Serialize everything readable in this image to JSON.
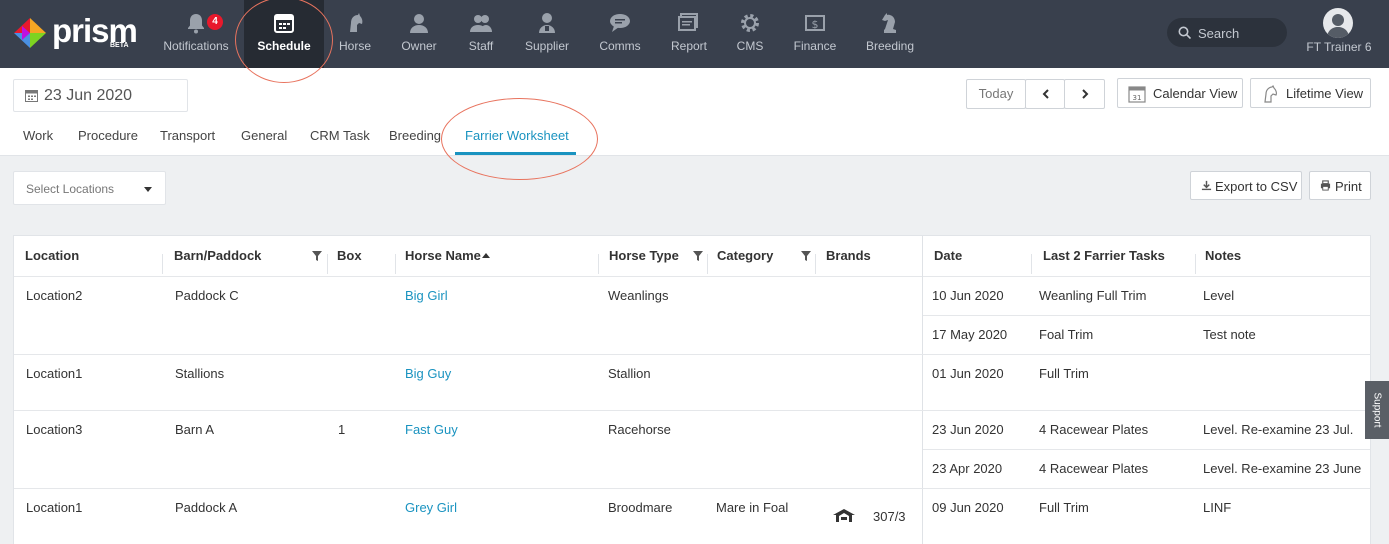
{
  "app": {
    "logo_text": "prism",
    "logo_badge": "BETA"
  },
  "nav": {
    "items": [
      {
        "label": "Notifications",
        "icon": "bell-icon",
        "badge": "4"
      },
      {
        "label": "Schedule",
        "icon": "calendar-icon",
        "active": true
      },
      {
        "label": "Horse",
        "icon": "horse-head-icon"
      },
      {
        "label": "Owner",
        "icon": "person-icon"
      },
      {
        "label": "Staff",
        "icon": "people-icon"
      },
      {
        "label": "Supplier",
        "icon": "supplier-icon"
      },
      {
        "label": "Comms",
        "icon": "chat-bubble-icon"
      },
      {
        "label": "Report",
        "icon": "report-icon"
      },
      {
        "label": "CMS",
        "icon": "gear-icon"
      },
      {
        "label": "Finance",
        "icon": "dollar-icon"
      },
      {
        "label": "Breeding",
        "icon": "chess-knight-icon"
      }
    ],
    "search_label": "Search",
    "user_name": "FT Trainer 6"
  },
  "header": {
    "date": "23 Jun 2020",
    "today_label": "Today",
    "calendar_view_label": "Calendar View",
    "calendar_icon_day": "31",
    "lifetime_view_label": "Lifetime View"
  },
  "tabs": [
    "Work",
    "Procedure",
    "Transport",
    "General",
    "CRM Task",
    "Breeding",
    "Farrier Worksheet"
  ],
  "active_tab": "Farrier Worksheet",
  "toolbar": {
    "select_locations": "Select Locations",
    "export_label": "Export to CSV",
    "print_label": "Print"
  },
  "table": {
    "columns": [
      "Location",
      "Barn/Paddock",
      "Box",
      "Horse Name",
      "Horse Type",
      "Category",
      "Brands",
      "Date",
      "Last 2 Farrier Tasks",
      "Notes"
    ],
    "rows": [
      {
        "location": "Location2",
        "barn": "Paddock C",
        "box": "",
        "horse": "Big Girl",
        "type": "Weanlings",
        "category": "",
        "brand": "",
        "tasks": [
          {
            "date": "10 Jun 2020",
            "task": "Weanling Full Trim",
            "notes": "Level"
          },
          {
            "date": "17 May 2020",
            "task": "Foal Trim",
            "notes": "Test note"
          }
        ]
      },
      {
        "location": "Location1",
        "barn": "Stallions",
        "box": "",
        "horse": "Big Guy",
        "type": "Stallion",
        "category": "",
        "brand": "",
        "tasks": [
          {
            "date": "01 Jun 2020",
            "task": "Full Trim",
            "notes": ""
          }
        ]
      },
      {
        "location": "Location3",
        "barn": "Barn A",
        "box": "1",
        "horse": "Fast Guy",
        "type": "Racehorse",
        "category": "",
        "brand": "",
        "tasks": [
          {
            "date": "23 Jun 2020",
            "task": "4 Racewear Plates",
            "notes": "Level. Re-examine 23 Jul."
          },
          {
            "date": "23 Apr 2020",
            "task": "4 Racewear Plates",
            "notes": "Level. Re-examine 23 June"
          }
        ]
      },
      {
        "location": "Location1",
        "barn": "Paddock A",
        "box": "",
        "horse": "Grey Girl",
        "type": "Broodmare",
        "category": "Mare in Foal",
        "brand": "307/3",
        "tasks": [
          {
            "date": "09 Jun 2020",
            "task": "Full Trim",
            "notes": "LINF"
          }
        ]
      }
    ]
  },
  "support_label": "Support",
  "colors": {
    "nav_bg": "#39404d",
    "nav_active_bg": "#262b33",
    "accent": "#1a93c0",
    "badge": "#e8192c",
    "highlight_circle": "#e8735e"
  }
}
